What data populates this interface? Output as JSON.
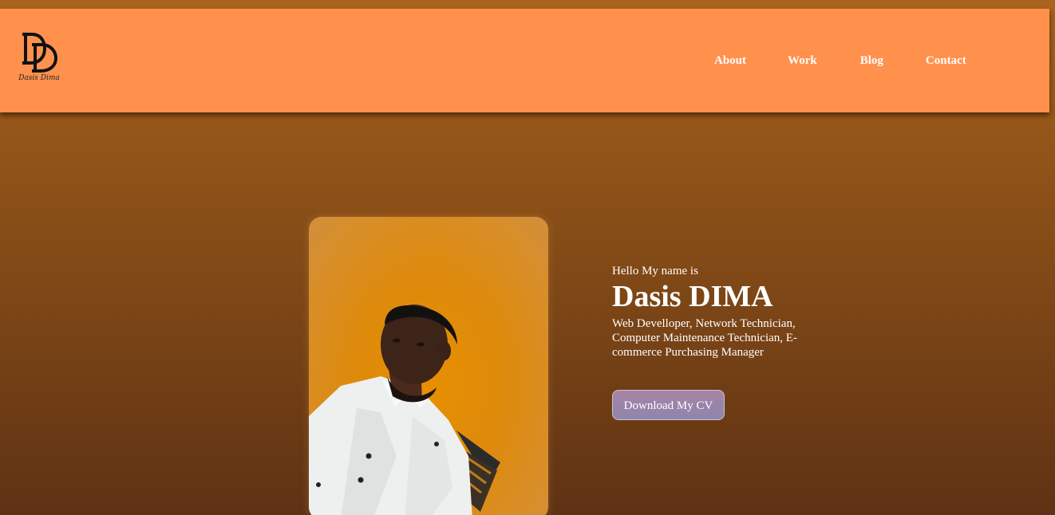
{
  "header": {
    "logo": {
      "monogram": "DD",
      "script_text": "Dasis Dima"
    },
    "nav": {
      "items": [
        {
          "label": "About"
        },
        {
          "label": "Work"
        },
        {
          "label": "Blog"
        },
        {
          "label": "Contact"
        }
      ]
    }
  },
  "hero": {
    "greeting": "Hello My name is",
    "name": "Dasis DIMA",
    "roles": "Web Develloper, Network Technician, Computer Maintenance Technician, E-commerce Purchasing Manager",
    "cv_button_label": "Download My CV"
  },
  "colors": {
    "header_bg": "#ff914d",
    "page_gradient_top": "#a8621c",
    "page_gradient_bottom": "#5e3214",
    "text": "#ffffff",
    "button_bg": "#9a85a8"
  }
}
